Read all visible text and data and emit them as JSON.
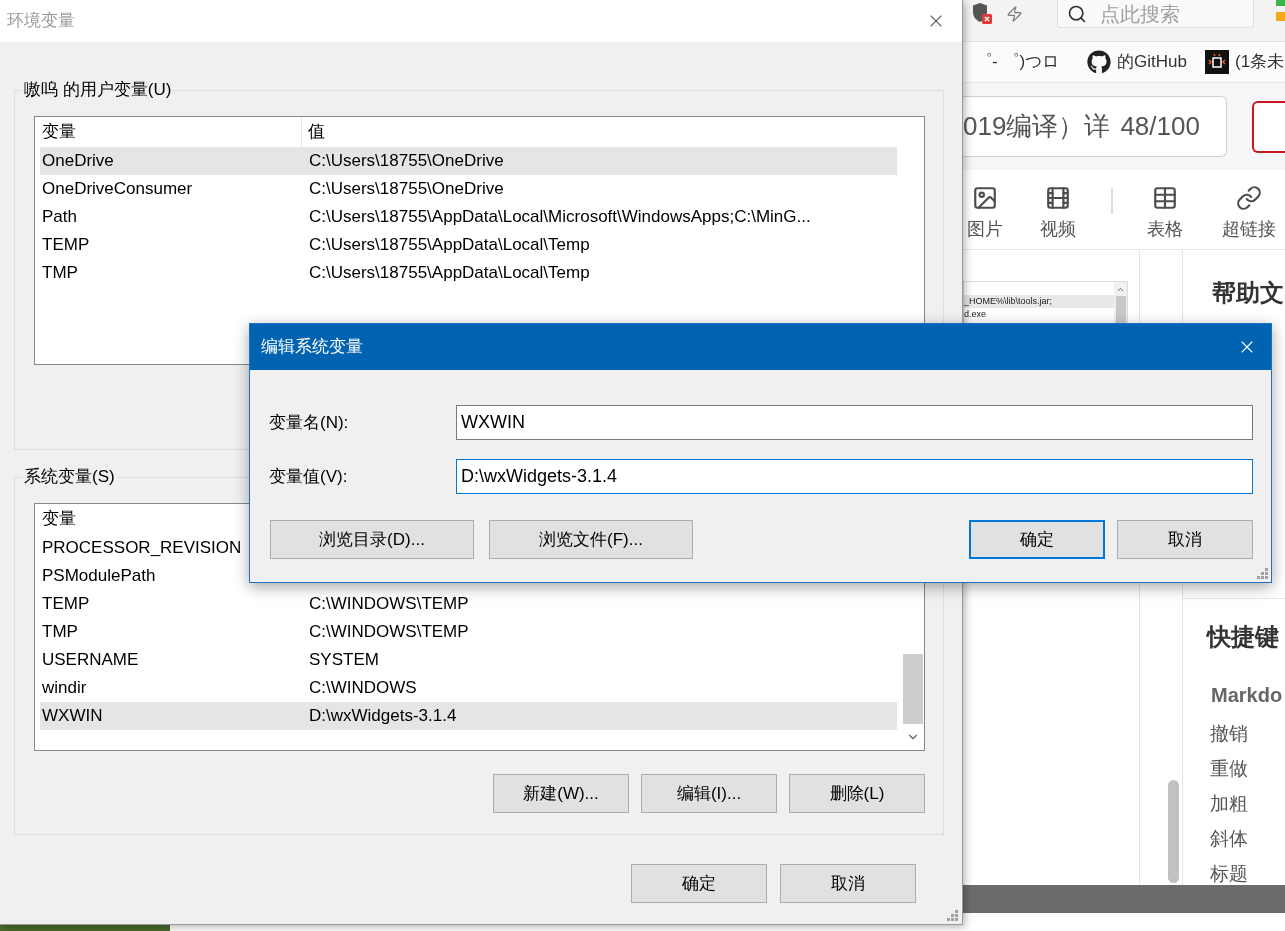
{
  "browser": {
    "search": {
      "placeholder": "点此搜索"
    },
    "bookmarks": [
      {
        "kind": "text",
        "label": "゜- ゜)つロ"
      },
      {
        "kind": "github",
        "label": "的GitHub"
      },
      {
        "kind": "tile",
        "label": "(1条未"
      }
    ],
    "title_field": {
      "value": "019编译）详",
      "counter": "48/100"
    },
    "toolbar": [
      {
        "kind": "image",
        "label": "图片"
      },
      {
        "kind": "video",
        "label": "视频"
      },
      {
        "kind": "divider"
      },
      {
        "kind": "table",
        "label": "表格"
      },
      {
        "kind": "link",
        "label": "超链接"
      }
    ],
    "embedded_screenshot": {
      "lines": [
        {
          "text": "_HOME%\\lib\\tools.jar;",
          "selected": true
        },
        {
          "text": "d.exe",
          "selected": false
        }
      ]
    },
    "help_panel": {
      "title": "帮助文",
      "shortcuts_title": "快捷键",
      "section": "Markdo",
      "items": [
        "撤销",
        "重做",
        "加粗",
        "斜体",
        "标题"
      ]
    }
  },
  "env_dialog": {
    "title": "环境变量",
    "active": false,
    "user_group": {
      "label": "嗷呜 的用户变量(U)",
      "columns": [
        "变量",
        "值"
      ],
      "rows": [
        {
          "name": "OneDrive",
          "value": "C:\\Users\\18755\\OneDrive",
          "selected": true
        },
        {
          "name": "OneDriveConsumer",
          "value": "C:\\Users\\18755\\OneDrive",
          "selected": false
        },
        {
          "name": "Path",
          "value": "C:\\Users\\18755\\AppData\\Local\\Microsoft\\WindowsApps;C:\\MinG...",
          "selected": false
        },
        {
          "name": "TEMP",
          "value": "C:\\Users\\18755\\AppData\\Local\\Temp",
          "selected": false
        },
        {
          "name": "TMP",
          "value": "C:\\Users\\18755\\AppData\\Local\\Temp",
          "selected": false
        }
      ]
    },
    "system_group": {
      "label": "系统变量(S)",
      "columns": [
        "变量"
      ],
      "rows": [
        {
          "name": "PROCESSOR_REVISION",
          "selected": false
        },
        {
          "name": "PSModulePath",
          "selected": false
        },
        {
          "name": "TEMP",
          "value": "C:\\WINDOWS\\TEMP",
          "selected": false
        },
        {
          "name": "TMP",
          "value": "C:\\WINDOWS\\TEMP",
          "selected": false
        },
        {
          "name": "USERNAME",
          "value": "SYSTEM",
          "selected": false
        },
        {
          "name": "windir",
          "value": "C:\\WINDOWS",
          "selected": false
        },
        {
          "name": "WXWIN",
          "value": "D:\\wxWidgets-3.1.4",
          "selected": true
        }
      ],
      "buttons": [
        "新建(W)...",
        "编辑(I)...",
        "删除(L)"
      ]
    },
    "buttons": [
      "确定",
      "取消"
    ]
  },
  "edit_dialog": {
    "title": "编辑系统变量",
    "active": true,
    "fields": [
      {
        "label": "变量名(N):",
        "value": "WXWIN",
        "focused": false
      },
      {
        "label": "变量值(V):",
        "value": "D:\\wxWidgets-3.1.4",
        "focused": true
      }
    ],
    "browse_buttons": [
      "浏览目录(D)...",
      "浏览文件(F)..."
    ],
    "buttons": [
      {
        "label": "确定",
        "default": true
      },
      {
        "label": "取消",
        "default": false
      }
    ]
  }
}
